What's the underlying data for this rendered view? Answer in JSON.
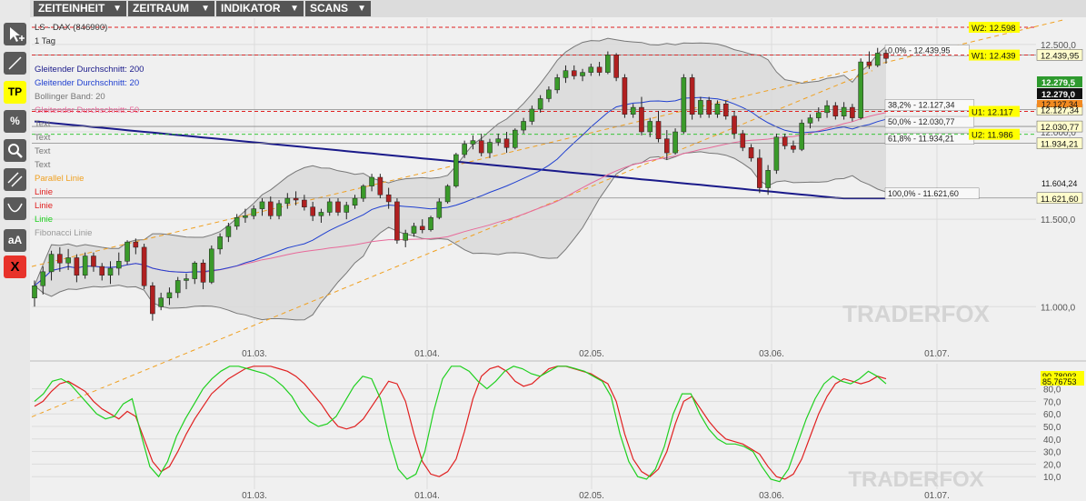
{
  "menu": [
    {
      "label": "ZEITEINHEIT"
    },
    {
      "label": "ZEITRAUM"
    },
    {
      "label": "INDIKATOR"
    },
    {
      "label": "SCANS"
    }
  ],
  "tools": [
    {
      "name": "cursor-tool-icon",
      "label": ""
    },
    {
      "name": "line-tool-icon",
      "label": ""
    },
    {
      "name": "tp-tool-button",
      "label": "TP"
    },
    {
      "name": "percent-tool-button",
      "label": "%"
    },
    {
      "name": "search-tool-icon",
      "label": ""
    },
    {
      "name": "parallel-tool-icon",
      "label": ""
    },
    {
      "name": "curve-tool-icon",
      "label": ""
    },
    {
      "name": "text-tool-button",
      "label": "aA"
    },
    {
      "name": "delete-tool-button",
      "label": "X"
    }
  ],
  "colors": {
    "accent_yellow": "#ffff00",
    "delete_red": "#e8322a",
    "candle_up": "#3a9a2a",
    "candle_down": "#b02020"
  },
  "chart_data": {
    "type": "candlestick",
    "title": "LS - DAX (846900)",
    "interval": "1 Tag",
    "legend": [
      {
        "label": "Gleitender Durchschnitt: 200",
        "color": "#1a1a8a"
      },
      {
        "label": "Gleitender Durchschnitt: 20",
        "color": "#2040d0"
      },
      {
        "label": "Bollinger Band: 20",
        "color": "#777777"
      },
      {
        "label": "Gleitender Durchschnitt: 50",
        "color": "#e86a9a"
      },
      {
        "label": "Text",
        "color": "#777777"
      },
      {
        "label": "Text",
        "color": "#777777"
      },
      {
        "label": "Text",
        "color": "#777777"
      },
      {
        "label": "Text",
        "color": "#777777"
      },
      {
        "label": "Parallel Linie",
        "color": "#f0a020"
      },
      {
        "label": "Linie",
        "color": "#e02020"
      },
      {
        "label": "Linie",
        "color": "#e02020"
      },
      {
        "label": "Linie",
        "color": "#20d020"
      },
      {
        "label": "Fibonacci Linie",
        "color": "#999999"
      }
    ],
    "x_ticks": [
      "01.03.",
      "01.04.",
      "02.05.",
      "03.06.",
      "01.07."
    ],
    "y_ticks": [
      "12.500,0",
      "12.000,0",
      "11.500,0",
      "11.000,0"
    ],
    "y_range": [
      10700,
      12650
    ],
    "fib_levels": [
      {
        "label": "0,0% - 12.439,95",
        "value": 12439.95,
        "right_label": "12.439,95"
      },
      {
        "label": "38,2% - 12.127,34",
        "value": 12127.34,
        "right_label": "12.127,34"
      },
      {
        "label": "50,0% - 12.030,77",
        "value": 12030.77,
        "right_label": "12.030,77"
      },
      {
        "label": "61,8% - 11.934,21",
        "value": 11934.21,
        "right_label": "11.934,21"
      },
      {
        "label": "100,0% - 11.621,60",
        "value": 11621.6,
        "right_label": "11.621,60"
      }
    ],
    "extra_right_labels": [
      "11.604,24",
      "12.127,34"
    ],
    "price_boxes": [
      {
        "label": "12.279,5",
        "value": 12279.5,
        "bg": "#2e9a2e"
      },
      {
        "label": "12.279,0",
        "value": 12279.0,
        "bg": "#111111"
      }
    ],
    "levels": [
      {
        "label": "W2: 12.598",
        "value": 12598,
        "color": "#e02020",
        "dash": true
      },
      {
        "label": "W1: 12.439",
        "value": 12439,
        "color": "#e02020",
        "dash": true
      },
      {
        "label": "U1: 12.117",
        "value": 12117,
        "color": "#e02020",
        "dash": true
      },
      {
        "label": "U2: 11.986",
        "value": 11986,
        "color": "#20c020",
        "dash": true
      }
    ],
    "candles": [
      [
        11050,
        11150,
        11000,
        11120
      ],
      [
        11120,
        11230,
        11070,
        11200
      ],
      [
        11200,
        11320,
        11150,
        11300
      ],
      [
        11300,
        11340,
        11200,
        11250
      ],
      [
        11250,
        11330,
        11210,
        11280
      ],
      [
        11280,
        11300,
        11140,
        11180
      ],
      [
        11180,
        11310,
        11160,
        11290
      ],
      [
        11290,
        11310,
        11200,
        11230
      ],
      [
        11230,
        11250,
        11150,
        11180
      ],
      [
        11180,
        11260,
        11130,
        11220
      ],
      [
        11220,
        11310,
        11180,
        11260
      ],
      [
        11260,
        11380,
        11240,
        11370
      ],
      [
        11370,
        11390,
        11300,
        11340
      ],
      [
        11340,
        11360,
        11100,
        11120
      ],
      [
        11120,
        11140,
        10920,
        10960
      ],
      [
        11000,
        11080,
        10980,
        11050
      ],
      [
        11050,
        11110,
        11010,
        11080
      ],
      [
        11080,
        11170,
        11050,
        11150
      ],
      [
        11150,
        11190,
        11100,
        11160
      ],
      [
        11160,
        11260,
        11130,
        11250
      ],
      [
        11250,
        11270,
        11100,
        11140
      ],
      [
        11140,
        11350,
        11130,
        11330
      ],
      [
        11330,
        11420,
        11300,
        11400
      ],
      [
        11400,
        11480,
        11370,
        11460
      ],
      [
        11460,
        11530,
        11440,
        11510
      ],
      [
        11510,
        11560,
        11480,
        11520
      ],
      [
        11520,
        11580,
        11500,
        11560
      ],
      [
        11560,
        11620,
        11520,
        11600
      ],
      [
        11600,
        11630,
        11500,
        11520
      ],
      [
        11520,
        11610,
        11500,
        11590
      ],
      [
        11590,
        11650,
        11560,
        11620
      ],
      [
        11620,
        11660,
        11580,
        11610
      ],
      [
        11610,
        11640,
        11550,
        11570
      ],
      [
        11570,
        11600,
        11490,
        11520
      ],
      [
        11520,
        11560,
        11480,
        11540
      ],
      [
        11540,
        11620,
        11520,
        11600
      ],
      [
        11600,
        11620,
        11520,
        11540
      ],
      [
        11540,
        11600,
        11500,
        11580
      ],
      [
        11580,
        11640,
        11560,
        11620
      ],
      [
        11620,
        11700,
        11600,
        11690
      ],
      [
        11690,
        11760,
        11660,
        11740
      ],
      [
        11740,
        11760,
        11620,
        11640
      ],
      [
        11640,
        11680,
        11560,
        11600
      ],
      [
        11600,
        11620,
        11360,
        11380
      ],
      [
        11380,
        11440,
        11340,
        11420
      ],
      [
        11420,
        11480,
        11400,
        11460
      ],
      [
        11460,
        11500,
        11420,
        11440
      ],
      [
        11440,
        11520,
        11430,
        11510
      ],
      [
        11510,
        11620,
        11500,
        11600
      ],
      [
        11600,
        11700,
        11590,
        11690
      ],
      [
        11690,
        11880,
        11680,
        11870
      ],
      [
        11870,
        11950,
        11850,
        11930
      ],
      [
        11930,
        11980,
        11900,
        11950
      ],
      [
        11950,
        11990,
        11860,
        11880
      ],
      [
        11880,
        11960,
        11850,
        11940
      ],
      [
        11940,
        11990,
        11920,
        11960
      ],
      [
        11960,
        12000,
        11880,
        11910
      ],
      [
        11910,
        12020,
        11900,
        12010
      ],
      [
        12010,
        12080,
        11990,
        12060
      ],
      [
        12060,
        12150,
        12040,
        12130
      ],
      [
        12130,
        12210,
        12110,
        12190
      ],
      [
        12190,
        12260,
        12170,
        12240
      ],
      [
        12240,
        12330,
        12220,
        12310
      ],
      [
        12310,
        12380,
        12280,
        12350
      ],
      [
        12350,
        12380,
        12300,
        12320
      ],
      [
        12320,
        12360,
        12290,
        12340
      ],
      [
        12340,
        12390,
        12320,
        12370
      ],
      [
        12370,
        12400,
        12320,
        12340
      ],
      [
        12340,
        12460,
        12330,
        12440
      ],
      [
        12440,
        12450,
        12290,
        12310
      ],
      [
        12310,
        12330,
        12080,
        12100
      ],
      [
        12100,
        12160,
        12080,
        12140
      ],
      [
        12140,
        12200,
        11980,
        12000
      ],
      [
        12000,
        12080,
        11970,
        12060
      ],
      [
        12060,
        12120,
        11940,
        11960
      ],
      [
        11960,
        12010,
        11840,
        11880
      ],
      [
        11880,
        12020,
        11870,
        12000
      ],
      [
        12000,
        12330,
        11990,
        12310
      ],
      [
        12310,
        12330,
        12070,
        12100
      ],
      [
        12100,
        12200,
        12080,
        12180
      ],
      [
        12180,
        12200,
        12080,
        12100
      ],
      [
        12100,
        12180,
        12080,
        12160
      ],
      [
        12160,
        12180,
        12070,
        12090
      ],
      [
        12090,
        12120,
        11960,
        11990
      ],
      [
        11990,
        12010,
        11890,
        11910
      ],
      [
        11910,
        11930,
        11830,
        11850
      ],
      [
        11850,
        11900,
        11650,
        11680
      ],
      [
        11680,
        11810,
        11640,
        11780
      ],
      [
        11780,
        11990,
        11760,
        11970
      ],
      [
        11970,
        11990,
        11900,
        11920
      ],
      [
        11920,
        11950,
        11880,
        11900
      ],
      [
        11900,
        12070,
        11890,
        12050
      ],
      [
        12050,
        12100,
        12020,
        12080
      ],
      [
        12080,
        12140,
        12060,
        12110
      ],
      [
        12110,
        12180,
        12080,
        12150
      ],
      [
        12150,
        12170,
        12070,
        12090
      ],
      [
        12090,
        12170,
        12070,
        12140
      ],
      [
        12140,
        12160,
        12060,
        12080
      ],
      [
        12080,
        12420,
        12070,
        12400
      ],
      [
        12400,
        12460,
        12360,
        12380
      ],
      [
        12380,
        12480,
        12370,
        12450
      ],
      [
        12450,
        12470,
        12390,
        12420
      ]
    ],
    "oscillator": {
      "type": "line",
      "y_ticks": [
        "80,0",
        "70,0",
        "60,0",
        "50,0",
        "40,0",
        "30,0",
        "20,0",
        "10,0"
      ],
      "y_range": [
        0,
        100
      ],
      "right_labels": [
        "85,76753",
        "90,78093"
      ],
      "series": [
        {
          "color": "#e02020",
          "values": [
            66,
            70,
            78,
            84,
            86,
            82,
            78,
            70,
            64,
            60,
            56,
            62,
            58,
            40,
            22,
            14,
            18,
            30,
            44,
            56,
            66,
            76,
            82,
            88,
            92,
            96,
            98,
            98,
            98,
            96,
            94,
            90,
            84,
            76,
            68,
            58,
            50,
            48,
            50,
            56,
            66,
            76,
            86,
            84,
            70,
            44,
            22,
            12,
            10,
            14,
            24,
            46,
            72,
            90,
            96,
            98,
            94,
            86,
            82,
            84,
            90,
            96,
            98,
            98,
            96,
            94,
            92,
            88,
            84,
            70,
            44,
            24,
            14,
            10,
            16,
            30,
            52,
            70,
            74,
            64,
            54,
            46,
            40,
            38,
            36,
            32,
            28,
            18,
            10,
            8,
            12,
            24,
            42,
            60,
            74,
            84,
            88,
            86,
            84,
            86,
            90,
            88
          ]
        },
        {
          "color": "#20d020",
          "values": [
            70,
            76,
            86,
            88,
            84,
            76,
            68,
            60,
            56,
            58,
            68,
            72,
            44,
            18,
            10,
            22,
            42,
            56,
            68,
            80,
            88,
            94,
            98,
            98,
            96,
            94,
            92,
            88,
            82,
            74,
            62,
            54,
            50,
            52,
            58,
            70,
            82,
            90,
            88,
            72,
            40,
            16,
            8,
            12,
            30,
            62,
            88,
            98,
            98,
            94,
            86,
            80,
            86,
            94,
            98,
            96,
            92,
            90,
            94,
            98,
            98,
            96,
            94,
            90,
            86,
            74,
            44,
            22,
            10,
            8,
            16,
            34,
            60,
            76,
            76,
            60,
            48,
            40,
            36,
            36,
            34,
            30,
            18,
            8,
            6,
            16,
            36,
            56,
            72,
            84,
            90,
            86,
            84,
            88,
            94,
            90,
            84
          ]
        }
      ]
    },
    "watermark": "TRADERFOX"
  }
}
